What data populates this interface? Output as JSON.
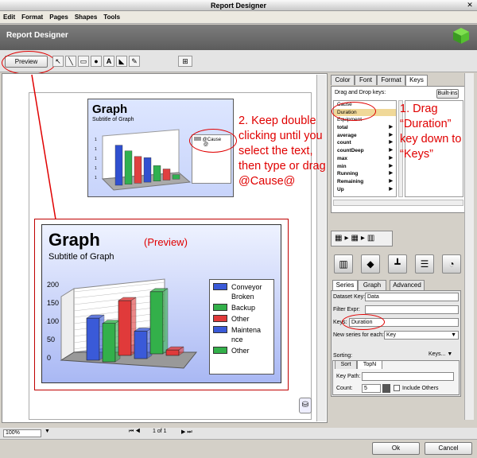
{
  "window": {
    "title": "Report Designer",
    "header_title": "Report Designer"
  },
  "menu": [
    "Edit",
    "Format",
    "Pages",
    "Shapes",
    "Tools"
  ],
  "toolbar": {
    "preview_label": "Preview"
  },
  "tools": [
    "pointer-tool-icon",
    "line-tool-icon",
    "rectangle-tool-icon",
    "ellipse-tool-icon",
    "text-tool-icon",
    "shape-tool-icon",
    "pen-tool-icon"
  ],
  "mini_graph": {
    "title": "Graph",
    "subtitle": "Subtitle of Graph",
    "legend": [
      "@Cause",
      "@"
    ],
    "y_ticks": [
      "1",
      "1",
      "1",
      "1",
      "1"
    ],
    "bars": [
      0.9,
      0.75,
      0.6,
      0.55,
      0.35,
      0.25,
      0.1
    ],
    "bar_colors": [
      "#3050d0",
      "#30b050",
      "#e04040",
      "#3050d0",
      "#30b050",
      "#e04040",
      "#30b050"
    ]
  },
  "callouts": {
    "left": "2. Keep double clicking until you select the text, then type or drag @Cause@",
    "right": "1. Drag “Duration” key down to “Keys”"
  },
  "preview": {
    "label": "(Preview)",
    "chart_data": {
      "type": "bar",
      "title": "Graph",
      "subtitle": "Subtitle of Graph",
      "categories": [
        "Conveyor Broken",
        "Backup",
        "Other",
        "Maintenance",
        "Other"
      ],
      "values": [
        115,
        105,
        150,
        75,
        170,
        15
      ],
      "colors": [
        "#3a5ad8",
        "#33b04a",
        "#e03a3a",
        "#3a5ad8",
        "#33b04a",
        "#e03a3a"
      ],
      "legend": [
        {
          "label": "Conveyor",
          "label2": "Broken",
          "color": "#3a5ad8"
        },
        {
          "label": "Backup",
          "color": "#33b04a"
        },
        {
          "label": "Other",
          "color": "#e03a3a"
        },
        {
          "label": "Maintena",
          "label2": "nce",
          "color": "#3a5ad8"
        },
        {
          "label": "Other",
          "color": "#33b04a"
        }
      ],
      "y_ticks": [
        "200",
        "150",
        "100",
        "50",
        "0"
      ],
      "ylim": [
        0,
        200
      ]
    }
  },
  "status": {
    "zoom": "100%",
    "page": "1 of 1"
  },
  "right_panel": {
    "tabs": [
      "Color",
      "Font",
      "Format",
      "Keys"
    ],
    "drag_drop_label": "Drag and Drop keys:",
    "builtins_label": "Built-ins",
    "keys": [
      {
        "label": "Cause",
        "arrow": false
      },
      {
        "label": "Duration",
        "arrow": false,
        "selected": true
      },
      {
        "label": "Equipment",
        "arrow": false
      },
      {
        "label": "total",
        "arrow": true
      },
      {
        "label": "average",
        "arrow": true
      },
      {
        "label": "count",
        "arrow": true
      },
      {
        "label": "countDeep",
        "arrow": true
      },
      {
        "label": "max",
        "arrow": true
      },
      {
        "label": "min",
        "arrow": true
      },
      {
        "label": "Running",
        "arrow": true
      },
      {
        "label": "Remaining",
        "arrow": true
      },
      {
        "label": "Up",
        "arrow": true
      }
    ],
    "series_tabs": [
      "Series",
      "Graph",
      "Advanced"
    ],
    "dataset_key_label": "Dataset Key:",
    "dataset_key_value": "Data",
    "filter_expr_label": "Filter Expr:",
    "filter_expr_value": "",
    "keys_label": "Keys:",
    "keys_value": "Duration",
    "new_series_label": "New series for each:",
    "new_series_value": "Key",
    "sorting_label": "Sorting:",
    "sort_keys_label": "Keys... ▼",
    "sort_tab": "Sort",
    "topn_tab": "TopN",
    "key_path_label": "Key Path:",
    "count_label": "Count:",
    "count_value": "5",
    "include_others_label": "Include Others"
  },
  "buttons": {
    "ok": "Ok",
    "cancel": "Cancel"
  }
}
